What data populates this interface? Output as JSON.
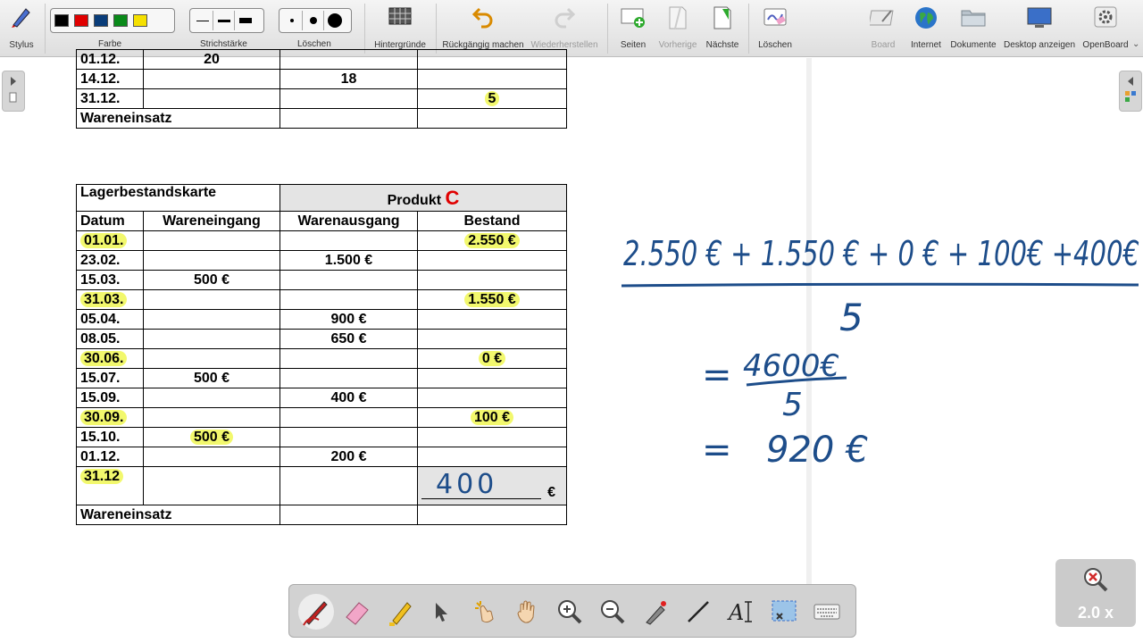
{
  "toolbar": {
    "stylus": "Stylus",
    "farbe": "Farbe",
    "strichstaerke": "Strichstärke",
    "loeschen_size": "Löschen",
    "hintergruende": "Hintergründe",
    "undo": "Rückgängig machen",
    "redo": "Wiederherstellen",
    "seiten": "Seiten",
    "vorherige": "Vorherige",
    "naechste": "Nächste",
    "loeschen": "Löschen",
    "board": "Board",
    "internet": "Internet",
    "dokumente": "Dokumente",
    "desktop": "Desktop anzeigen",
    "openboard": "OpenBoard",
    "colors": [
      "#000000",
      "#e00000",
      "#0a3d7a",
      "#0a8a1a",
      "#f5e000"
    ]
  },
  "table_top": {
    "rows": [
      [
        "01.12.",
        "20",
        "",
        ""
      ],
      [
        "14.12.",
        "",
        "18",
        ""
      ],
      [
        "31.12.",
        "",
        "",
        "5"
      ]
    ],
    "footer": "Wareneinsatz"
  },
  "table_c": {
    "title": "Lagerbestandskarte",
    "product_label": "Produkt",
    "product_letter": "C",
    "headers": [
      "Datum",
      "Wareneingang",
      "Warenausgang",
      "Bestand"
    ],
    "rows": [
      [
        "01.01.",
        "",
        "",
        "2.550 €"
      ],
      [
        "23.02.",
        "",
        "1.500 €",
        ""
      ],
      [
        "15.03.",
        "500 €",
        "",
        ""
      ],
      [
        "31.03.",
        "",
        "",
        "1.550 €"
      ],
      [
        "05.04.",
        "",
        "900 €",
        ""
      ],
      [
        "08.05.",
        "",
        "650 €",
        ""
      ],
      [
        "30.06.",
        "",
        "",
        "0 €"
      ],
      [
        "15.07.",
        "500 €",
        "",
        ""
      ],
      [
        "15.09.",
        "",
        "400 €",
        ""
      ],
      [
        "30.09.",
        "",
        "",
        "100 €"
      ],
      [
        "15.10.",
        "500 €",
        "",
        ""
      ],
      [
        "01.12.",
        "",
        "200 €",
        ""
      ]
    ],
    "last_date": "31.12",
    "last_value_handwritten": "400",
    "euro": "€",
    "footer": "Wareneinsatz"
  },
  "handwriting": {
    "numerator": "2.550 € + 1.550 € + 0 € + 100€ +400€",
    "denominator": "5",
    "step_numerator": "4600€",
    "step_denominator": "5",
    "result": "920 €",
    "equals": "="
  },
  "zoom": {
    "label": "2.0 x"
  }
}
